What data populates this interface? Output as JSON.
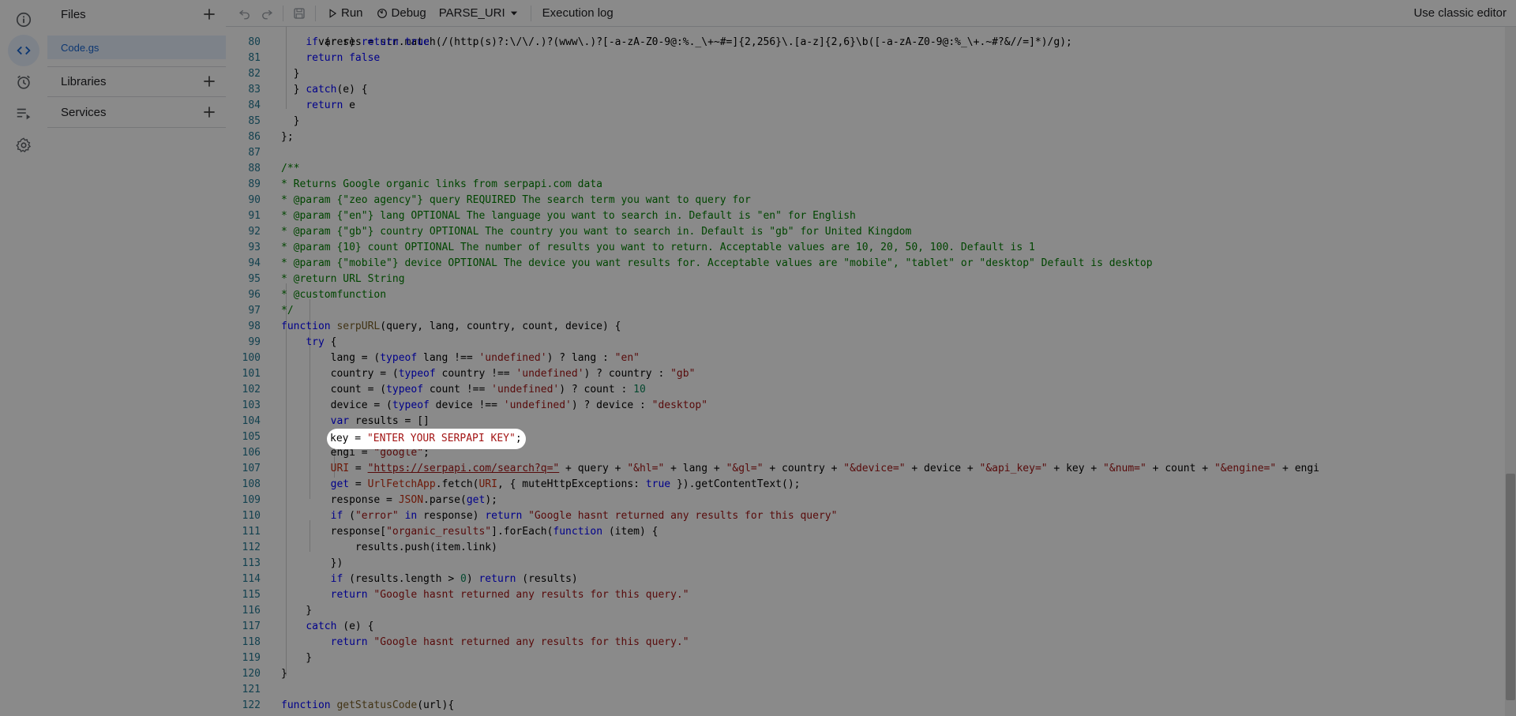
{
  "rail": {
    "icons": [
      "info-icon",
      "code-icon",
      "alarm-clock-icon",
      "executions-icon",
      "settings-gear-icon"
    ]
  },
  "files": {
    "files_header": "Files",
    "file_name": "Code.gs",
    "libraries_header": "Libraries",
    "services_header": "Services"
  },
  "toolbar": {
    "run_label": "Run",
    "debug_label": "Debug",
    "function_select": "PARSE_URI",
    "execution_log_label": "Execution log",
    "classic_editor_label": "Use classic editor"
  },
  "editor": {
    "line_numbers": [
      "80",
      "81",
      "82",
      "83",
      "84",
      "85",
      "86",
      "87",
      "88",
      "89",
      "90",
      "91",
      "92",
      "93",
      "94",
      "95",
      "96",
      "97",
      "98",
      "99",
      "100",
      "101",
      "102",
      "103",
      "104",
      "105",
      "106",
      "107",
      "108",
      "109",
      "110",
      "111",
      "112",
      "113",
      "114",
      "115",
      "116",
      "117",
      "118",
      "119",
      "120",
      "121",
      "122"
    ],
    "partial_top_line": "var res = str.match(/(http(s)?:\\/\\/.)?(www\\.)?[-a-zA-Z0-9@:%._\\+~#=]{2,256}\\.[a-z]{2,6}\\b([-a-zA-Z0-9@:%_\\+.~#?&//=]*)/g);",
    "highlighted_line": "key = \"ENTER YOUR SERPAPI KEY\";"
  },
  "colors": {
    "accent": "#1967d2",
    "keyword": "#0000ff",
    "string": "#a31515",
    "number": "#098658",
    "comment": "#008000",
    "line_number": "#237893"
  }
}
